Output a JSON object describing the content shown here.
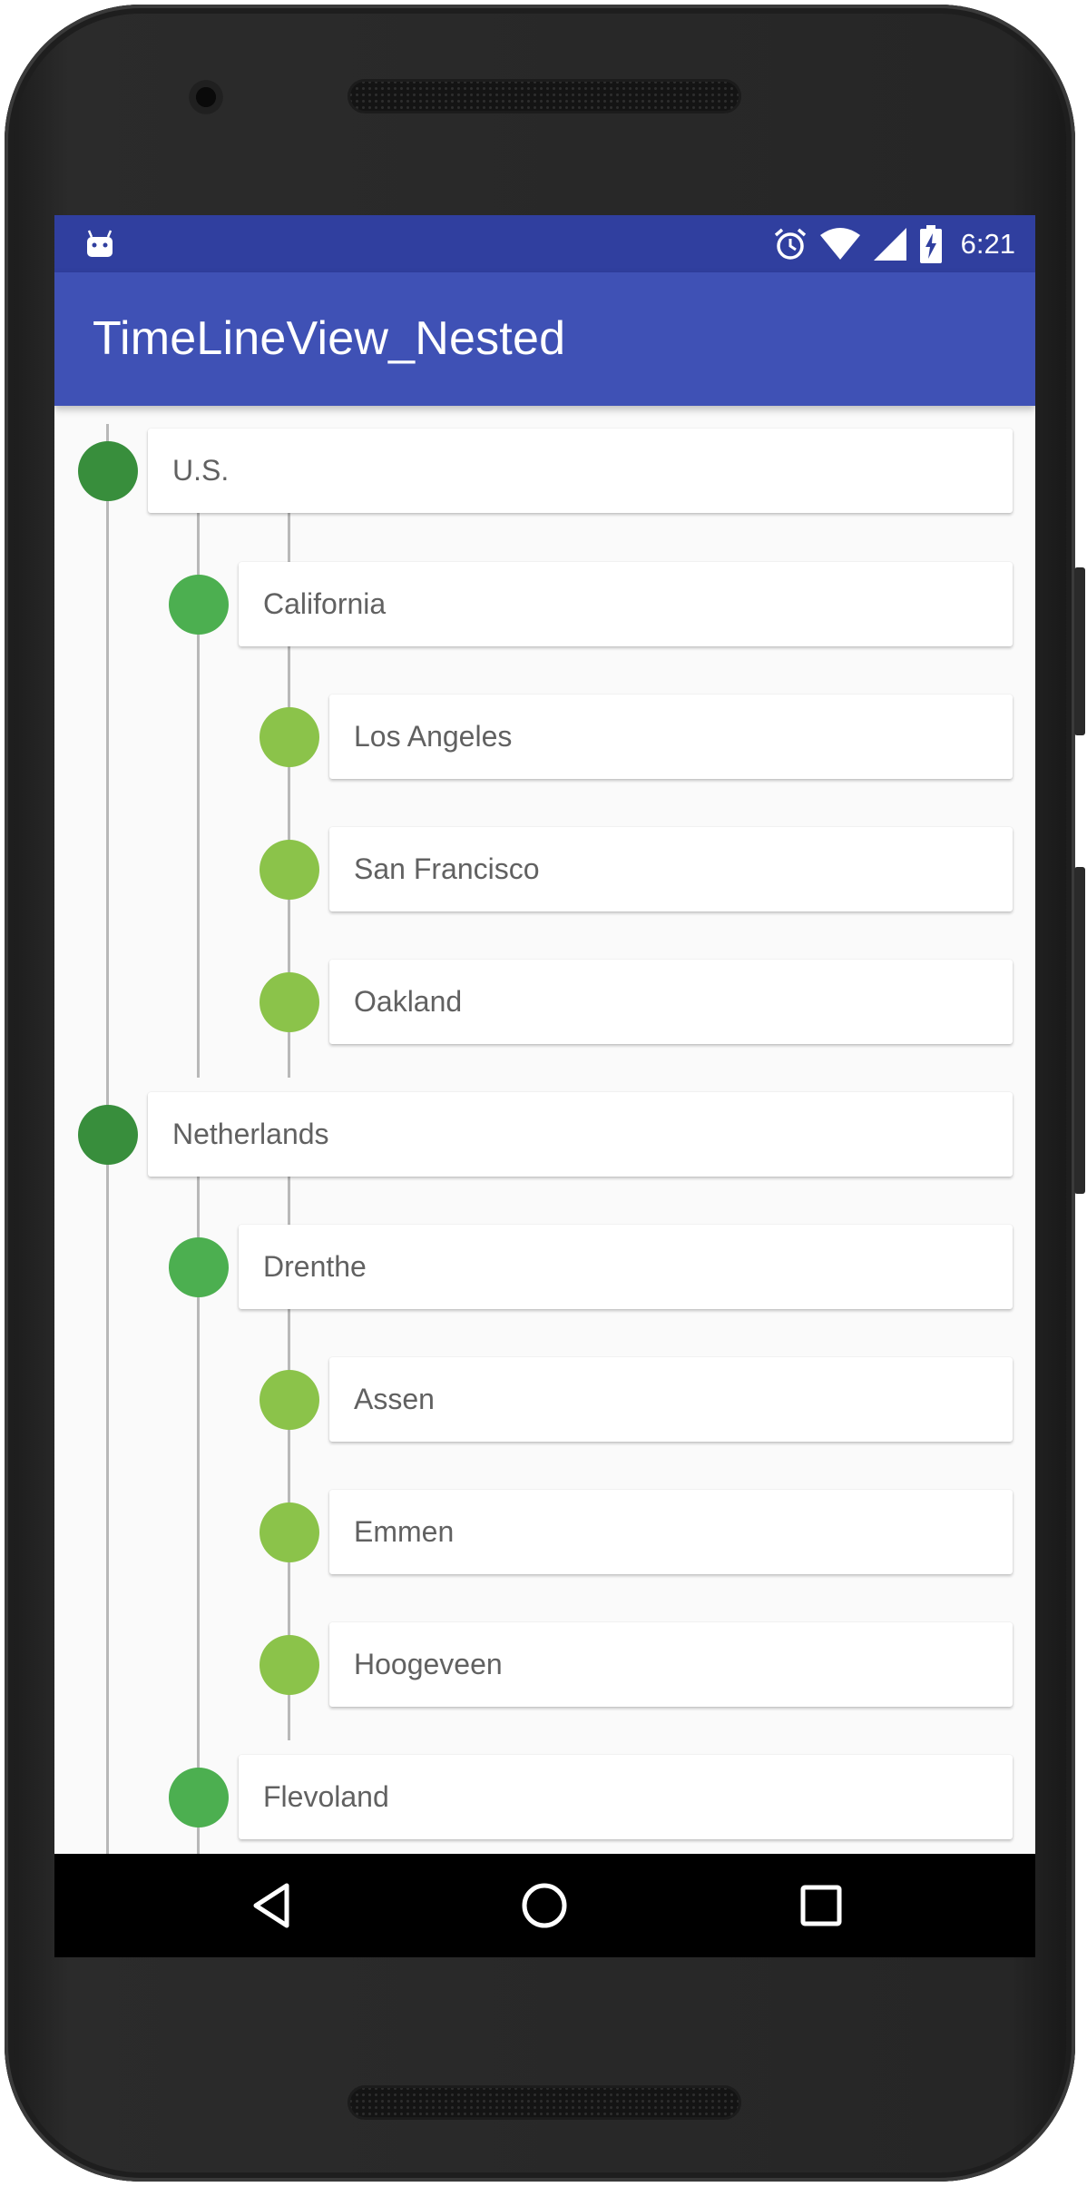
{
  "status_bar": {
    "time": "6:21",
    "icons": [
      "android-notification-icon",
      "alarm-icon",
      "wifi-icon",
      "cell-signal-icon",
      "battery-charging-icon"
    ]
  },
  "app_bar": {
    "title": "TimeLineView_Nested"
  },
  "timeline": {
    "items": [
      {
        "label": "U.S.",
        "level": 1
      },
      {
        "label": "California",
        "level": 2
      },
      {
        "label": "Los Angeles",
        "level": 3
      },
      {
        "label": "San Francisco",
        "level": 3
      },
      {
        "label": "Oakland",
        "level": 3
      },
      {
        "label": "Netherlands",
        "level": 1
      },
      {
        "label": "Drenthe",
        "level": 2
      },
      {
        "label": "Assen",
        "level": 3
      },
      {
        "label": "Emmen",
        "level": 3
      },
      {
        "label": "Hoogeveen",
        "level": 3
      },
      {
        "label": "Flevoland",
        "level": 2
      }
    ],
    "colors": {
      "level1": "#388e3c",
      "level2": "#4caf50",
      "level3": "#8bc34a",
      "line": "#b8b8b8"
    }
  },
  "nav_bar": {
    "icons": [
      "back-icon",
      "home-icon",
      "recents-icon"
    ]
  },
  "colors": {
    "status_bar": "#303f9f",
    "app_bar": "#3f51b5",
    "background": "#fafafa"
  }
}
